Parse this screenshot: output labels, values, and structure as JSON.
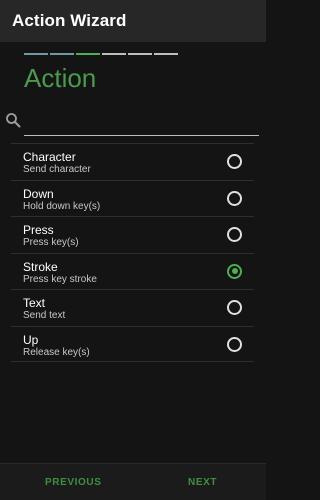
{
  "appbar": {
    "title": "Action Wizard"
  },
  "wizard": {
    "heading": "Action",
    "steps": [
      "done",
      "done",
      "active",
      "pending",
      "pending",
      "pending"
    ]
  },
  "search": {
    "value": "",
    "placeholder": ""
  },
  "options": [
    {
      "title": "Character",
      "subtitle": "Send character",
      "selected": false
    },
    {
      "title": "Down",
      "subtitle": "Hold down key(s)",
      "selected": false
    },
    {
      "title": "Press",
      "subtitle": "Press key(s)",
      "selected": false
    },
    {
      "title": "Stroke",
      "subtitle": "Press key stroke",
      "selected": true
    },
    {
      "title": "Text",
      "subtitle": "Send text",
      "selected": false
    },
    {
      "title": "Up",
      "subtitle": "Release key(s)",
      "selected": false
    }
  ],
  "footer": {
    "previous_label": "PREVIOUS",
    "next_label": "NEXT"
  },
  "colors": {
    "accent": "#4caf50",
    "heading": "#4b9a4e",
    "step_done": "#6f9aa3",
    "step_active": "#4caf50",
    "step_pending": "#bdbdbd",
    "button_text": "#3f8f43"
  },
  "icons": {
    "search": "search-icon"
  }
}
